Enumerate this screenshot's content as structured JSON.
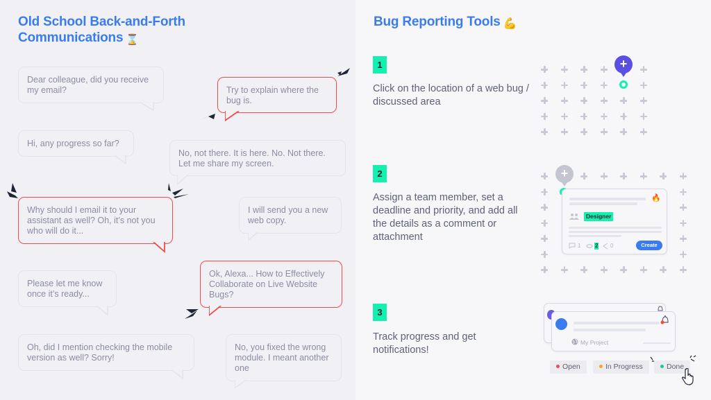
{
  "left": {
    "title_line1": "Old School Back-and-Forth",
    "title_line2": "Communications",
    "title_emoji": "⌛",
    "bubbles": [
      {
        "text": "Dear colleague, did you receive my email?",
        "style": "neutral"
      },
      {
        "text": "Try to explain where the bug is.",
        "style": "highlight"
      },
      {
        "text": "Hi, any progress so far?",
        "style": "neutral"
      },
      {
        "text": "No, not there. It is here. No. Not there. Let me share my screen.",
        "style": "neutral"
      },
      {
        "text": "Why should I email it to your assistant as well? Oh, it’s not you who will do it...",
        "style": "highlight"
      },
      {
        "text": "I will send you a new web copy.",
        "style": "neutral"
      },
      {
        "text": "Please let me know once it’s ready...",
        "style": "neutral"
      },
      {
        "text": "Ok, Alexa... How to Effectively Collaborate on Live Website Bugs?",
        "style": "highlight"
      },
      {
        "text": "Oh, did I mention checking the mobile version as well? Sorry!",
        "style": "neutral"
      },
      {
        "text": "No, you fixed the wrong module. I meant another one",
        "style": "neutral"
      }
    ]
  },
  "right": {
    "title": "Bug Reporting Tools",
    "title_emoji": "💪",
    "steps": [
      {
        "number": "1",
        "text": "Click on the location of a web bug / discussed area"
      },
      {
        "number": "2",
        "text": "Assign a team member, set a deadline and priority, and add all the details as a comment or attachment"
      },
      {
        "number": "3",
        "text": "Track progress and get notifications!"
      }
    ],
    "pin_symbol": "+",
    "task_card": {
      "assignee_tag": "Designer",
      "priority_icon": "🔥",
      "comments_count": "1",
      "attachments_count": "2",
      "shares_count": "0",
      "create_label": "Create"
    },
    "notification_card": {
      "project_label": "My Project"
    },
    "statuses": [
      {
        "label": "Open",
        "color": "#ef4b4b"
      },
      {
        "label": "In Progress",
        "color": "#f5a623"
      },
      {
        "label": "Done",
        "color": "#14c99a"
      }
    ]
  },
  "colors": {
    "accent_blue": "#3a7cf0",
    "highlight_red": "#ef4b4b",
    "mint": "#14f0b0",
    "pin_purple": "#5a4fe0"
  }
}
